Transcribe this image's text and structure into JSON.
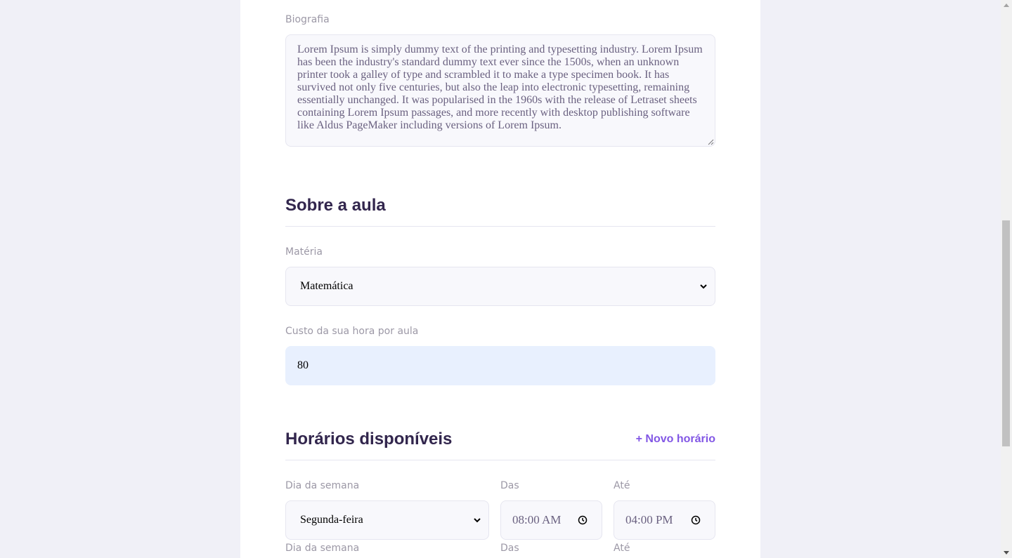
{
  "profile": {
    "bio_label": "Biografia",
    "bio_value": "Lorem Ipsum is simply dummy text of the printing and typesetting industry. Lorem Ipsum has been the industry's standard dummy text ever since the 1500s, when an unknown printer took a galley of type and scrambled it to make a type specimen book. It has survived not only five centuries, but also the leap into electronic typesetting, remaining essentially unchanged. It was popularised in the 1960s with the release of Letraset sheets containing Lorem Ipsum passages, and more recently with desktop publishing software like Aldus PageMaker including versions of Lorem Ipsum."
  },
  "class_info": {
    "title": "Sobre a aula",
    "subject_label": "Matéria",
    "subject_value": "Matemática",
    "cost_label": "Custo da sua hora por aula",
    "cost_value": "80"
  },
  "schedule": {
    "title": "Horários disponíveis",
    "new_slot_label": "+ Novo horário",
    "items": [
      {
        "weekday_label": "Dia da semana",
        "weekday_value": "Segunda-feira",
        "from_label": "Das",
        "from_value": "08:00 AM",
        "to_label": "Até",
        "to_value": "04:00 PM"
      },
      {
        "weekday_label": "Dia da semana",
        "from_label": "Das",
        "to_label": "Até"
      }
    ]
  },
  "colors": {
    "background": "#f0f0f7",
    "card": "#ffffff",
    "title_text": "#32264d",
    "label_text": "#9c98a6",
    "accent_link": "#8257e5",
    "input_background": "#f8f8fc",
    "autofill_background": "#e8f0fe"
  },
  "icons": {
    "select_arrow": "chevron-down-icon",
    "time_picker": "clock-icon"
  }
}
